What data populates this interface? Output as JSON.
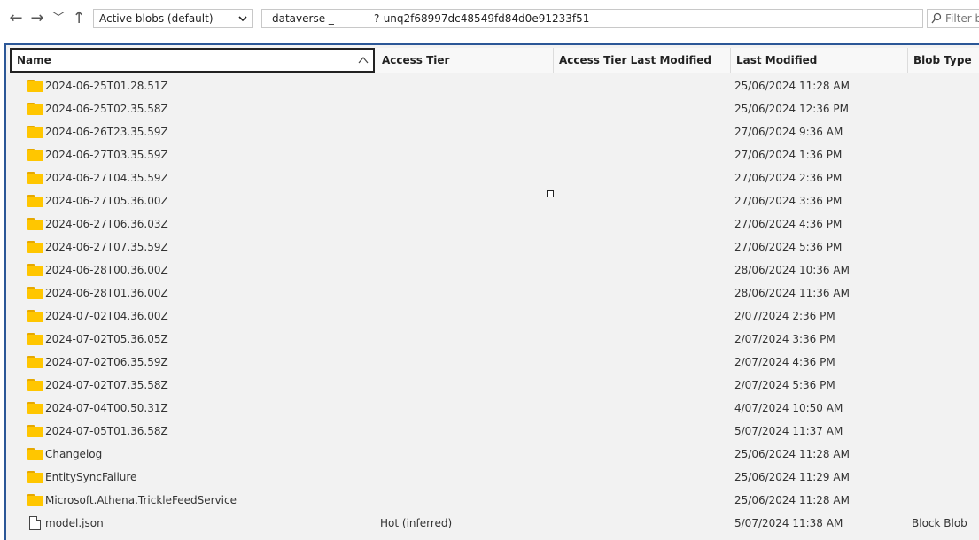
{
  "toolbar": {
    "back_icon": "←",
    "forward_icon": "→",
    "recent_icon": "﹀",
    "up_icon": "↑",
    "blob_filter": {
      "selected": "Active blobs (default)"
    },
    "path": {
      "part1": "dataverse _",
      "part2": "?-unq2f68997dc48549fd84d0e91233f51"
    },
    "filter_placeholder": "Filter b"
  },
  "columns": {
    "name": "Name",
    "access_tier": "Access Tier",
    "access_tier_last_modified": "Access Tier Last Modified",
    "last_modified": "Last Modified",
    "blob_type": "Blob Type",
    "sort_indicator": "^"
  },
  "rows": [
    {
      "type": "folder",
      "name": "2024-06-25T01.28.51Z",
      "access_tier": "",
      "last_modified": "25/06/2024 11:28 AM",
      "blob_type": ""
    },
    {
      "type": "folder",
      "name": "2024-06-25T02.35.58Z",
      "access_tier": "",
      "last_modified": "25/06/2024 12:36 PM",
      "blob_type": ""
    },
    {
      "type": "folder",
      "name": "2024-06-26T23.35.59Z",
      "access_tier": "",
      "last_modified": "27/06/2024 9:36 AM",
      "blob_type": ""
    },
    {
      "type": "folder",
      "name": "2024-06-27T03.35.59Z",
      "access_tier": "",
      "last_modified": "27/06/2024 1:36 PM",
      "blob_type": ""
    },
    {
      "type": "folder",
      "name": "2024-06-27T04.35.59Z",
      "access_tier": "",
      "last_modified": "27/06/2024 2:36 PM",
      "blob_type": ""
    },
    {
      "type": "folder",
      "name": "2024-06-27T05.36.00Z",
      "access_tier": "",
      "last_modified": "27/06/2024 3:36 PM",
      "blob_type": ""
    },
    {
      "type": "folder",
      "name": "2024-06-27T06.36.03Z",
      "access_tier": "",
      "last_modified": "27/06/2024 4:36 PM",
      "blob_type": ""
    },
    {
      "type": "folder",
      "name": "2024-06-27T07.35.59Z",
      "access_tier": "",
      "last_modified": "27/06/2024 5:36 PM",
      "blob_type": ""
    },
    {
      "type": "folder",
      "name": "2024-06-28T00.36.00Z",
      "access_tier": "",
      "last_modified": "28/06/2024 10:36 AM",
      "blob_type": ""
    },
    {
      "type": "folder",
      "name": "2024-06-28T01.36.00Z",
      "access_tier": "",
      "last_modified": "28/06/2024 11:36 AM",
      "blob_type": ""
    },
    {
      "type": "folder",
      "name": "2024-07-02T04.36.00Z",
      "access_tier": "",
      "last_modified": "2/07/2024 2:36 PM",
      "blob_type": ""
    },
    {
      "type": "folder",
      "name": "2024-07-02T05.36.05Z",
      "access_tier": "",
      "last_modified": "2/07/2024 3:36 PM",
      "blob_type": ""
    },
    {
      "type": "folder",
      "name": "2024-07-02T06.35.59Z",
      "access_tier": "",
      "last_modified": "2/07/2024 4:36 PM",
      "blob_type": ""
    },
    {
      "type": "folder",
      "name": "2024-07-02T07.35.58Z",
      "access_tier": "",
      "last_modified": "2/07/2024 5:36 PM",
      "blob_type": ""
    },
    {
      "type": "folder",
      "name": "2024-07-04T00.50.31Z",
      "access_tier": "",
      "last_modified": "4/07/2024 10:50 AM",
      "blob_type": ""
    },
    {
      "type": "folder",
      "name": "2024-07-05T01.36.58Z",
      "access_tier": "",
      "last_modified": "5/07/2024 11:37 AM",
      "blob_type": ""
    },
    {
      "type": "folder",
      "name": "Changelog",
      "access_tier": "",
      "last_modified": "25/06/2024 11:28 AM",
      "blob_type": ""
    },
    {
      "type": "folder",
      "name": "EntitySyncFailure",
      "access_tier": "",
      "last_modified": "25/06/2024 11:29 AM",
      "blob_type": ""
    },
    {
      "type": "folder",
      "name": "Microsoft.Athena.TrickleFeedService",
      "access_tier": "",
      "last_modified": "25/06/2024 11:28 AM",
      "blob_type": ""
    },
    {
      "type": "file",
      "name": "model.json",
      "access_tier": "Hot (inferred)",
      "last_modified": "5/07/2024 11:38 AM",
      "blob_type": "Block Blob"
    }
  ],
  "colors": {
    "panel_border": "#2b5797",
    "folder": "#ffc600",
    "row_bg": "#f2f2f2"
  }
}
